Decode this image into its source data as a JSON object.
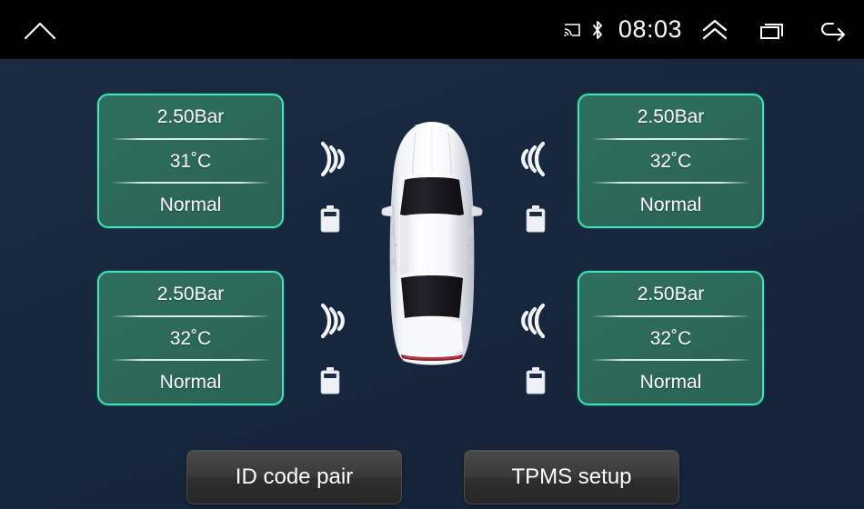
{
  "statusbar": {
    "home_icon": "home-icon",
    "cast_icon": "cast-icon",
    "bluetooth_icon": "bluetooth-icon",
    "time": "08:03",
    "expand_icon": "double-chevron-up-icon",
    "recents_icon": "recent-apps-icon",
    "back_icon": "back-arrow-icon",
    "background": "#000000"
  },
  "theme": {
    "background": "#16263c",
    "panel_border": "#3fe6b8",
    "panel_fill": "#2d6a5b",
    "text": "#ffffff",
    "button_fill": "#3b3b3b"
  },
  "tyres": [
    {
      "position": "front-left",
      "pressure": "2.50Bar",
      "temperature": "31˚C",
      "status": "Normal",
      "signal_icon": "signal-waves-icon",
      "battery_icon": "battery-icon"
    },
    {
      "position": "front-right",
      "pressure": "2.50Bar",
      "temperature": "32˚C",
      "status": "Normal",
      "signal_icon": "signal-waves-icon",
      "battery_icon": "battery-icon"
    },
    {
      "position": "rear-left",
      "pressure": "2.50Bar",
      "temperature": "32˚C",
      "status": "Normal",
      "signal_icon": "signal-waves-icon",
      "battery_icon": "battery-icon"
    },
    {
      "position": "rear-right",
      "pressure": "2.50Bar",
      "temperature": "32˚C",
      "status": "Normal",
      "signal_icon": "signal-waves-icon",
      "battery_icon": "battery-icon"
    }
  ],
  "vehicle": {
    "icon": "car-top-view-icon",
    "body_color": "#ffffff",
    "glass_color": "#1b1b1f"
  },
  "buttons": {
    "id_code_pair": "ID code pair",
    "tpms_setup": "TPMS setup"
  }
}
